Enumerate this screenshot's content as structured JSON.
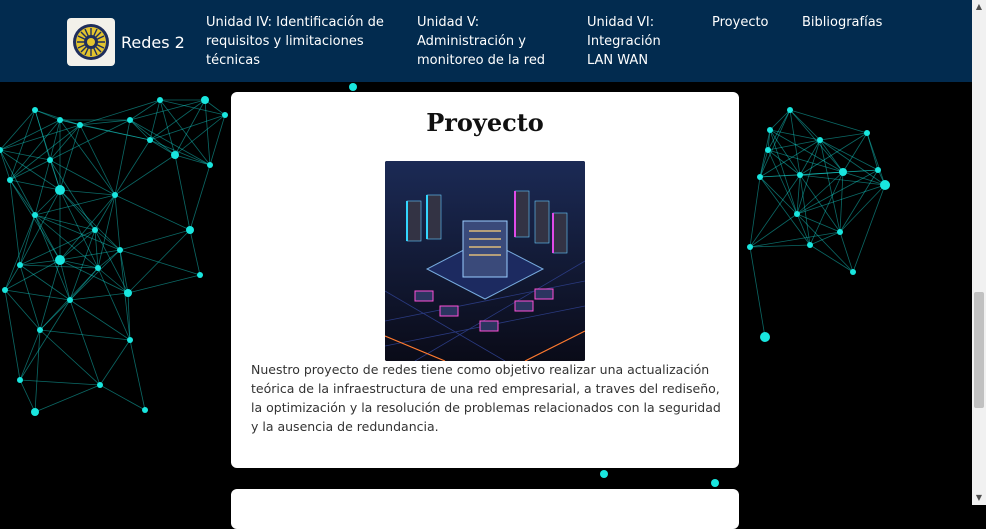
{
  "colors": {
    "navbar": "#022b4f",
    "network": "#19e6df",
    "background": "#000000"
  },
  "brand": {
    "logo_icon": "university-seal-icon",
    "title": "Redes 2"
  },
  "nav": [
    {
      "lines": [
        "Unidad IV: Identificación de",
        "requisitos y limitaciones",
        "técnicas"
      ]
    },
    {
      "lines": [
        "Unidad V:",
        "Administración y",
        "monitoreo de la red"
      ]
    },
    {
      "lines": [
        "Unidad VI:",
        "Integración",
        "LAN WAN"
      ]
    },
    {
      "lines": [
        "Proyecto"
      ]
    },
    {
      "lines": [
        "Bibliografías"
      ]
    }
  ],
  "card": {
    "title": "Proyecto",
    "image_icon": "datacenter-network-image",
    "text": "Nuestro proyecto de redes tiene como objetivo realizar una actualización teórica de la infraestructura de una red empresarial, a traves del rediseño, la optimización y la resolución de problemas relacionados con la seguridad y la ausencia de redundancia."
  },
  "scrollbar": {
    "position_fraction": 0.62
  }
}
